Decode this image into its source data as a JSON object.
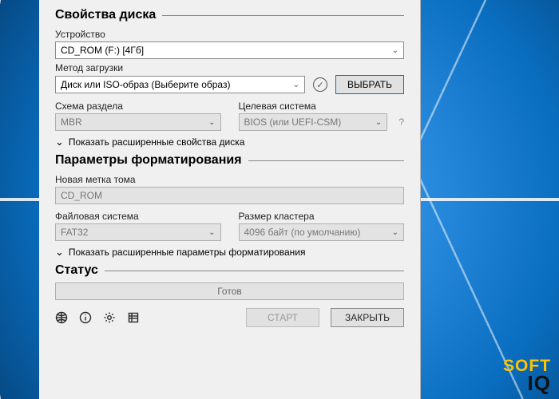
{
  "watermark": {
    "line1": "SOFT",
    "line2": "IQ"
  },
  "sections": {
    "drive": {
      "title": "Свойства диска",
      "device_label": "Устройство",
      "device_value": "CD_ROM (F:) [4Гб]",
      "boot_label": "Метод загрузки",
      "boot_value": "Диск или ISO-образ (Выберите образ)",
      "select_button": "ВЫБРАТЬ",
      "partition_label": "Схема раздела",
      "partition_value": "MBR",
      "target_label": "Целевая система",
      "target_value": "BIOS (или UEFI-CSM)",
      "advanced_toggle": "Показать расширенные свойства диска"
    },
    "format": {
      "title": "Параметры форматирования",
      "volume_label": "Новая метка тома",
      "volume_value": "CD_ROM",
      "filesystem_label": "Файловая система",
      "filesystem_value": "FAT32",
      "cluster_label": "Размер кластера",
      "cluster_value": "4096 байт (по умолчанию)",
      "advanced_toggle": "Показать расширенные параметры форматирования"
    },
    "status": {
      "title": "Статус",
      "value": "Готов"
    }
  },
  "footer": {
    "start": "СТАРТ",
    "close": "ЗАКРЫТЬ"
  },
  "help_marker": "?"
}
